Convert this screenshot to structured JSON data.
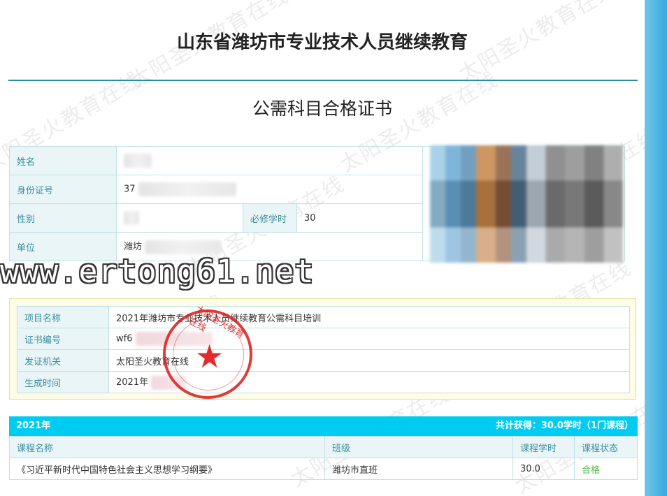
{
  "document": {
    "header_title": "山东省潍坊市专业技术人员继续教育",
    "certificate_title": "公需科目合格证书"
  },
  "watermark": {
    "text": "太阳圣火教育在线",
    "site_url": "www.ertong61.net"
  },
  "person": {
    "name_label": "姓名",
    "name_value": "",
    "id_label": "身份证号",
    "id_value": "37",
    "gender_label": "性别",
    "gender_value": "",
    "required_hours_label": "必修学时",
    "required_hours_value": "30",
    "unit_label": "单位",
    "unit_value": "潍坊"
  },
  "certificate": {
    "project_label": "项目名称",
    "project_value": "2021年潍坊市专业技术人员继续教育公需科目培训",
    "number_label": "证书编号",
    "number_value": "wf6",
    "issuer_label": "发证机关",
    "issuer_value": "太阳圣火教育在线",
    "date_label": "生成时间",
    "date_value": "2021年"
  },
  "seal": {
    "text": "太阳圣火教育在线"
  },
  "year_summary": {
    "year": "2021年",
    "total_prefix": "共计获得：",
    "total_hours": "30.0",
    "total_unit": "学时（",
    "course_count": "1",
    "course_suffix": "门课程）"
  },
  "courses": {
    "headers": [
      "课程名称",
      "班级",
      "课程学时",
      "课程状态"
    ],
    "rows": [
      {
        "name": "《习近平新时代中国特色社会主义思想学习纲要》",
        "class": "潍坊市直班",
        "hours": "30.0",
        "status": "合格"
      }
    ]
  },
  "colors": {
    "accent_teal": "#2a8f9a",
    "year_bar": "#00ccf2",
    "label_text": "#3c8ea0",
    "pass_green": "#52b848",
    "seal_red": "#dc1919",
    "right_rail": "#3aa9de"
  }
}
